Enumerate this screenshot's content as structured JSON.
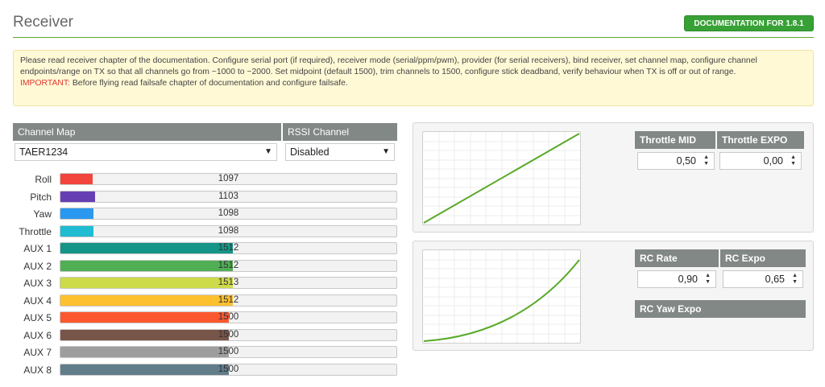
{
  "header": {
    "title": "Receiver",
    "doc_button": "DOCUMENTATION FOR 1.8.1"
  },
  "note": {
    "text": "Please read receiver chapter of the documentation. Configure serial port (if required), receiver mode (serial/ppm/pwm), provider (for serial receivers), bind receiver, set channel map, configure channel endpoints/range on TX so that all channels go from ~1000 to ~2000. Set midpoint (default 1500), trim channels to 1500, configure stick deadband, verify behaviour when TX is off or out of range.",
    "important_label": "IMPORTANT:",
    "important_text": " Before flying read failsafe chapter of documentation and configure failsafe."
  },
  "channel_map": {
    "label": "Channel Map",
    "value": "TAER1234"
  },
  "rssi": {
    "label": "RSSI Channel",
    "value": "Disabled"
  },
  "channels": [
    {
      "name": "Roll",
      "value": "1097",
      "level": 0.097,
      "color": "#f1453d"
    },
    {
      "name": "Pitch",
      "value": "1103",
      "level": 0.103,
      "color": "#673fb4"
    },
    {
      "name": "Yaw",
      "value": "1098",
      "level": 0.098,
      "color": "#2b98f0"
    },
    {
      "name": "Throttle",
      "value": "1098",
      "level": 0.098,
      "color": "#1fbcd2"
    },
    {
      "name": "AUX 1",
      "value": "1512",
      "level": 0.512,
      "color": "#159588"
    },
    {
      "name": "AUX 2",
      "value": "1512",
      "level": 0.512,
      "color": "#50ae55"
    },
    {
      "name": "AUX 3",
      "value": "1513",
      "level": 0.513,
      "color": "#cdda49"
    },
    {
      "name": "AUX 4",
      "value": "1512",
      "level": 0.512,
      "color": "#fdc02f"
    },
    {
      "name": "AUX 5",
      "value": "1500",
      "level": 0.5,
      "color": "#fc5830"
    },
    {
      "name": "AUX 6",
      "value": "1500",
      "level": 0.5,
      "color": "#785549"
    },
    {
      "name": "AUX 7",
      "value": "1500",
      "level": 0.5,
      "color": "#9e9e9e"
    },
    {
      "name": "AUX 8",
      "value": "1500",
      "level": 0.5,
      "color": "#617d8a"
    }
  ],
  "throttle": {
    "mid_label": "Throttle MID",
    "mid_value": "0,50",
    "expo_label": "Throttle EXPO",
    "expo_value": "0,00"
  },
  "rc": {
    "rate_label": "RC Rate",
    "rate_value": "0,90",
    "expo_label": "RC Expo",
    "expo_value": "0,65",
    "yaw_expo_label": "RC Yaw Expo"
  },
  "colors": {
    "accent": "#59aa29",
    "curve": "#59aa29",
    "header_bg": "#828885"
  }
}
